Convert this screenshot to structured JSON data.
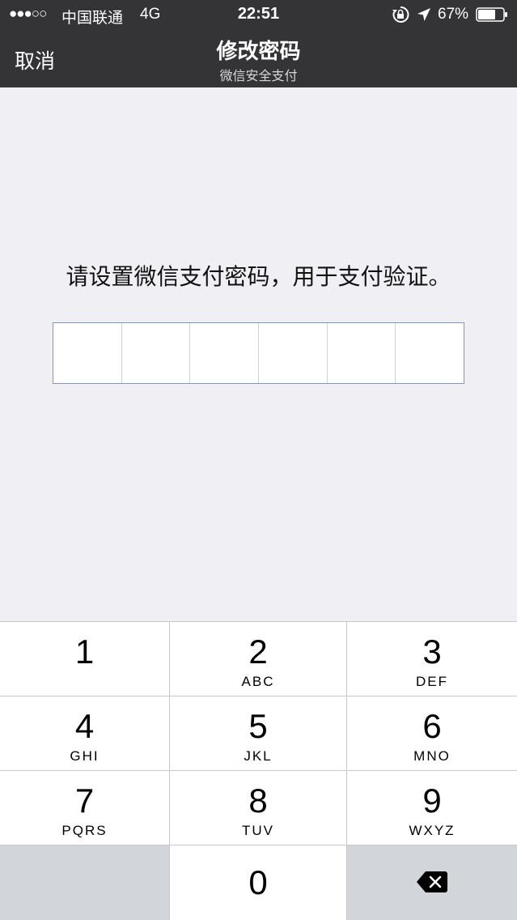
{
  "status_bar": {
    "signal": "●●●○○",
    "carrier": "中国联通",
    "network": "4G",
    "time": "22:51",
    "battery_percent": "67%",
    "icons": [
      "orientation-lock-icon",
      "location-arrow-icon",
      "battery-icon"
    ]
  },
  "nav": {
    "cancel_label": "取消",
    "title": "修改密码",
    "subtitle": "微信安全支付"
  },
  "prompt": "请设置微信支付密码，用于支付验证。",
  "pin": {
    "length": 6,
    "entered": 0
  },
  "keypad": {
    "keys": [
      {
        "digit": "1",
        "letters": ""
      },
      {
        "digit": "2",
        "letters": "ABC"
      },
      {
        "digit": "3",
        "letters": "DEF"
      },
      {
        "digit": "4",
        "letters": "GHI"
      },
      {
        "digit": "5",
        "letters": "JKL"
      },
      {
        "digit": "6",
        "letters": "MNO"
      },
      {
        "digit": "7",
        "letters": "PQRS"
      },
      {
        "digit": "8",
        "letters": "TUV"
      },
      {
        "digit": "9",
        "letters": "WXYZ"
      },
      {
        "digit": "0",
        "letters": ""
      }
    ],
    "backspace_icon": "backspace-icon"
  },
  "colors": {
    "header_bg": "#343437",
    "page_bg": "#efeff4",
    "pin_border": "#7d97c7"
  }
}
